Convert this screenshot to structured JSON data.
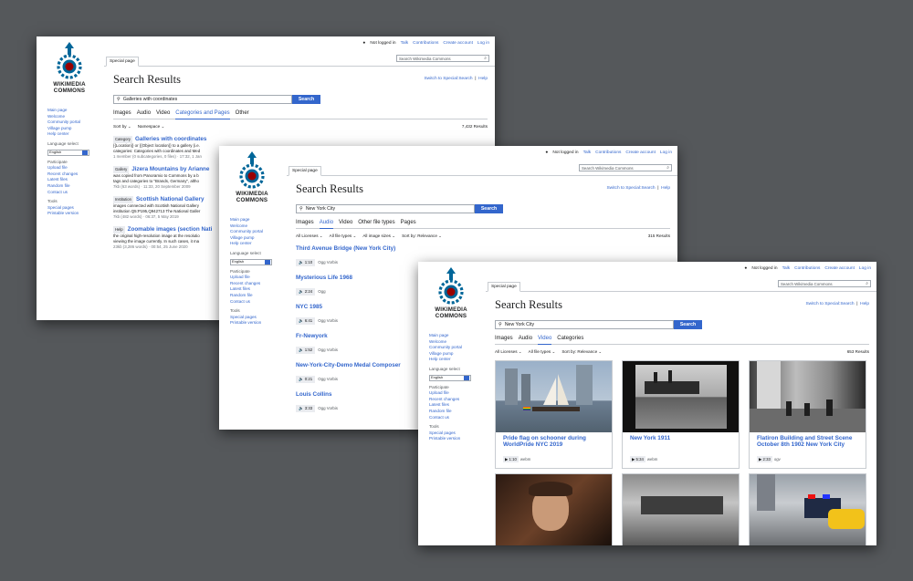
{
  "nav": {
    "not_logged_in": "Not logged in",
    "talk": "Talk",
    "contributions": "Contributions",
    "create_account": "Create account",
    "log_in": "Log in",
    "search_placeholder": "Search Wikimedia Commons",
    "special_page_tab": "Special page"
  },
  "logo": {
    "line1": "WIKIMEDIA",
    "line2": "COMMONS"
  },
  "sidebar": {
    "main_links": [
      "Main page",
      "Welcome",
      "Community portal",
      "Village pump",
      "Help center"
    ],
    "language_selector_label": "Language select",
    "language_value": "English",
    "participate_heading": "Participate",
    "participate_links": [
      "Upload file",
      "Recent changes",
      "Latest files",
      "Random file",
      "Contact us"
    ],
    "tools_heading": "Tools",
    "tools_links": [
      "Special pages",
      "Printable version"
    ]
  },
  "page": {
    "title": "Search Results",
    "switch_link": "Switch to Special:Search",
    "help_link": "Help",
    "search_button": "Search"
  },
  "window1": {
    "query": "Galleries with coordinates",
    "tabs": [
      "Images",
      "Audio",
      "Video",
      "Categories and Pages",
      "Other"
    ],
    "active_tab": 3,
    "filters": [
      "Sort by",
      "Namespace"
    ],
    "result_count": "7,432 Results",
    "results": [
      {
        "badge": "Category",
        "title": "Galleries with coordinates",
        "lines": [
          "{{Location}} or {{Object location}} to a gallery (i.e.",
          "categories: Categories with coordinates and Med"
        ],
        "meta": "1 member (0 subcategories, 0 files) · 17:32, 1 Jan"
      },
      {
        "badge": "Gallery",
        "title": "Jizera Mountains by Arianne",
        "lines": [
          "was copied from Panoramio to Commons by a b",
          "tags and categories to \"Brands, Germany\", altho"
        ],
        "meta": "7kb (63 words) · 11:33, 20 September 2009"
      },
      {
        "badge": "Institution",
        "title": "Scottish National Gallery",
        "lines": [
          "images connected with Scottish National Gallery",
          "institution Q5:P195,Q942713 The National Galler"
        ],
        "meta": "7kb (482 words) · 06:37, 5 May 2019"
      },
      {
        "badge": "Help",
        "title": "Zoomable images (section Nati",
        "lines": [
          "the original high-resolution image at the resolutio",
          "viewing the image currently. In such cases, it ma"
        ],
        "meta": "23kb (3,286 words) · 00:54, 25 June 2020"
      }
    ]
  },
  "window2": {
    "query": "New York City",
    "tabs": [
      "Images",
      "Audio",
      "Video",
      "Other file types",
      "Pages"
    ],
    "active_tab": 1,
    "filters": [
      "All Licenses",
      "All file types",
      "All image sizes",
      "Sort by: Relevance"
    ],
    "result_count": "315 Results",
    "results": [
      {
        "title": "Third Avenue Bridge (New York City)",
        "duration": "1:10",
        "format": "Ogg Vorbis"
      },
      {
        "title": "Mysterious Life 1968",
        "duration": "2:24",
        "format": "Ogg"
      },
      {
        "title": "NYC 1985",
        "duration": "6:41",
        "format": "Ogg Vorbis"
      },
      {
        "title": "Fr-Newyork",
        "duration": "1:52",
        "format": "Ogg Vorbis"
      },
      {
        "title": "New-York-City-Demo Medal Composer",
        "duration": "0:21",
        "format": "Ogg Vorbis"
      },
      {
        "title": "Louis Collins",
        "duration": "3:33",
        "format": "Ogg Vorbis"
      }
    ]
  },
  "window3": {
    "query": "New York City",
    "tabs": [
      "Images",
      "Audio",
      "Video",
      "Categories"
    ],
    "active_tab": 2,
    "filters": [
      "All Licenses",
      "All file types",
      "Sort by: Relevance"
    ],
    "result_count": "653 Results",
    "videos": [
      {
        "title": "Pride flag on schooner during WorldPride NYC 2019",
        "duration": "1:10",
        "format": "webm"
      },
      {
        "title": "New York 1911",
        "duration": "5:34",
        "format": "webm"
      },
      {
        "title": "Flatiron Building and Street Scene October 8th 1902 New York City",
        "duration": "2:33",
        "format": "ogv"
      },
      {
        "title": "",
        "duration": "",
        "format": ""
      },
      {
        "title": "",
        "duration": "",
        "format": ""
      },
      {
        "title": "",
        "duration": "",
        "format": ""
      }
    ]
  }
}
